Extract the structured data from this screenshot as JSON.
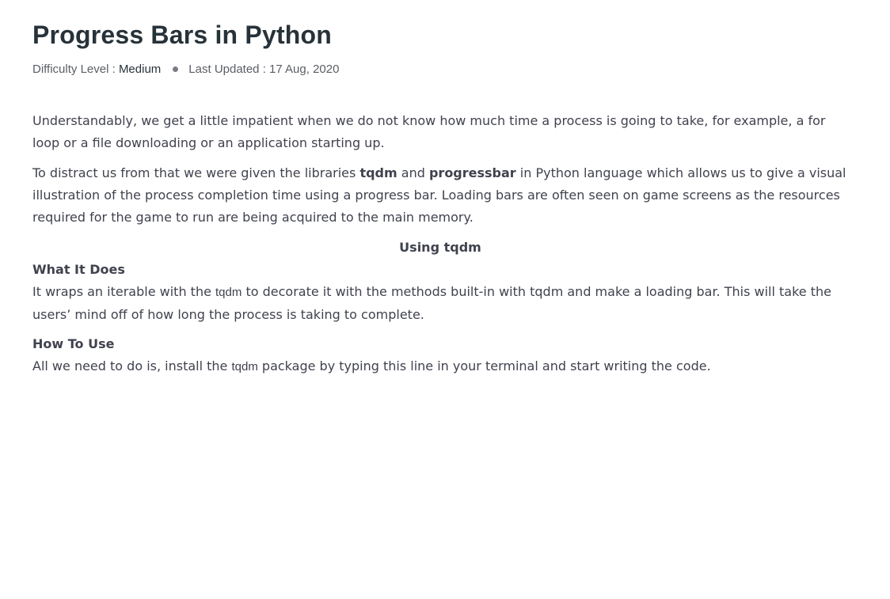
{
  "article": {
    "title": "Progress Bars in Python",
    "meta": {
      "difficulty_label": "Difficulty Level : ",
      "difficulty_value": "Medium",
      "updated_label": "Last Updated : 17 Aug, 2020"
    },
    "intro": "Understandably, we get a little impatient when we do not know how much time a process is going to take, for example, a for loop or a file downloading or an application starting up.",
    "p2": {
      "part1": "To distract us from that we were given the libraries ",
      "lib1": "tqdm",
      "part2": " and ",
      "lib2": "progressbar",
      "part3": " in Python language which allows us to give a visual illustration of the process completion time using a progress bar. Loading bars are often seen on game screens as the resources required for the game to run are being acquired to the main memory."
    },
    "section_heading": "Using tqdm",
    "what_it_does": {
      "heading": "What It Does",
      "part1": "It wraps an iterable with the ",
      "code": "tqdm",
      "part2": " to decorate it with the methods built-in with tqdm and make a loading bar. This will take the users’ mind off of how long the process is taking to complete."
    },
    "how_to_use": {
      "heading": "How To Use",
      "part1": "All we need to do is, install the ",
      "code": "tqdm",
      "part2": " package by typing this line in your terminal and start writing the code."
    }
  }
}
